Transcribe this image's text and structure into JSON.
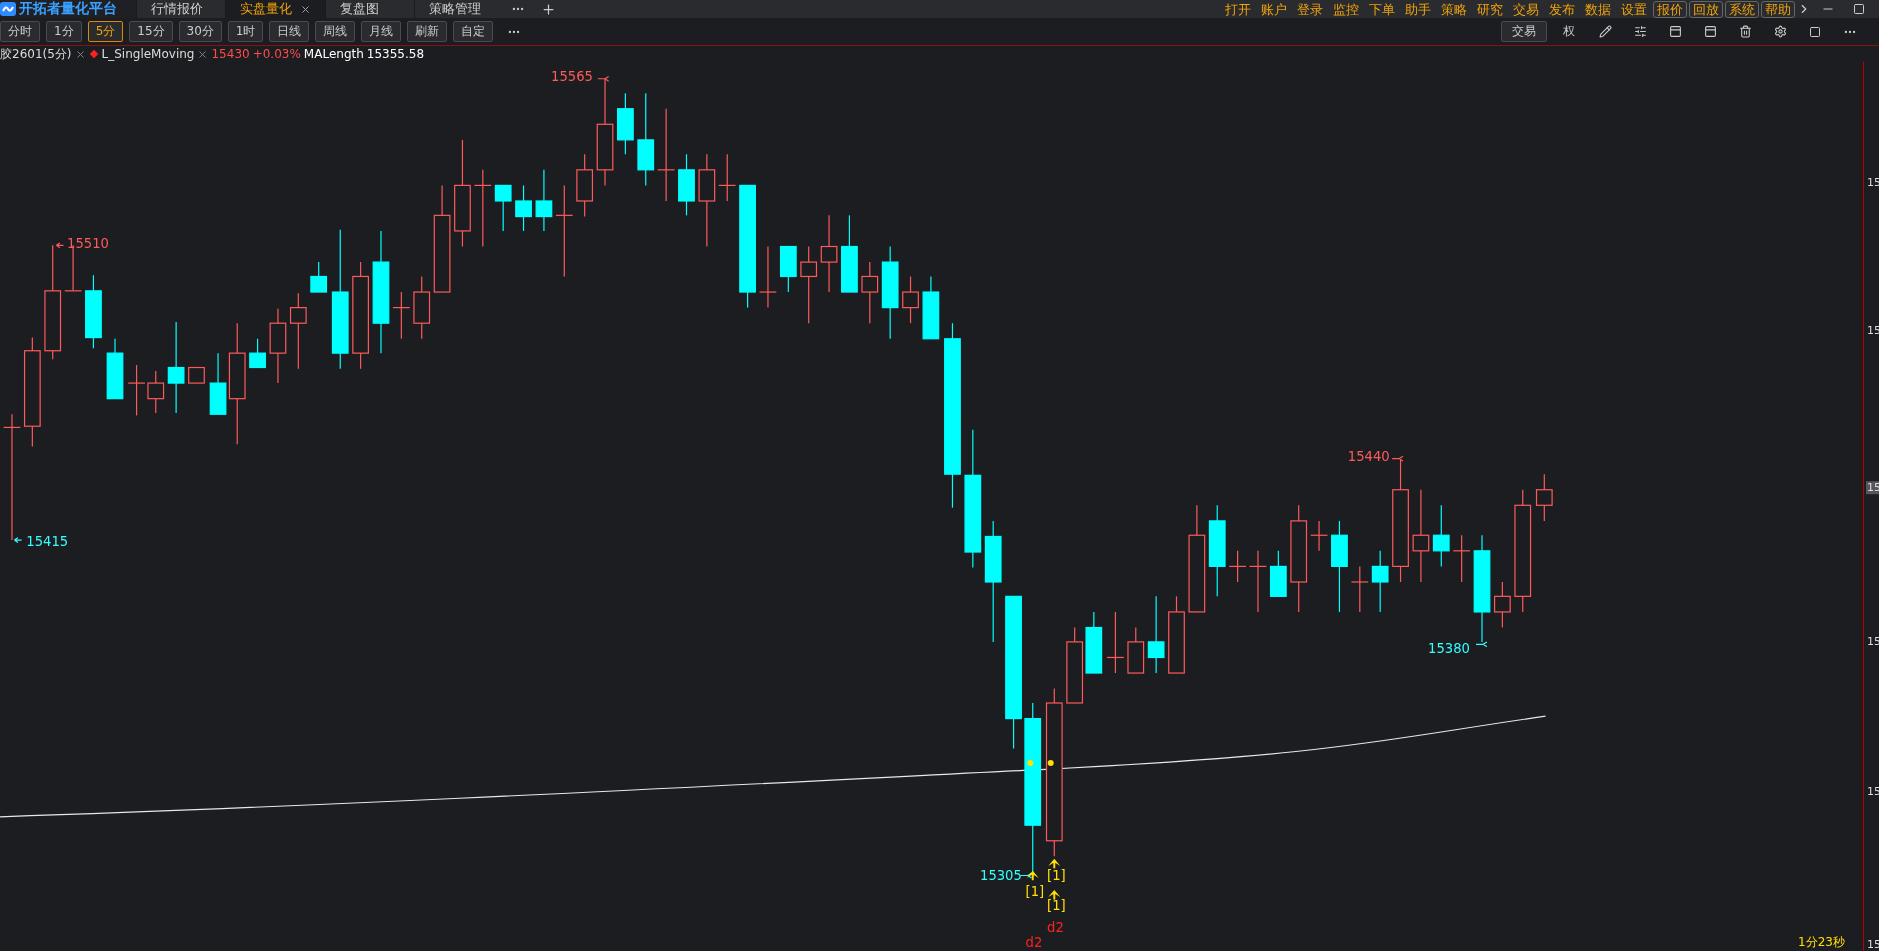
{
  "app": {
    "title": "开拓者量化平台"
  },
  "tabs": [
    {
      "label": "行情报价",
      "selected": false,
      "closable": false
    },
    {
      "label": "实盘量化",
      "selected": true,
      "closable": true
    },
    {
      "label": "复盘图",
      "selected": false,
      "closable": false
    },
    {
      "label": "策略管理",
      "selected": false,
      "closable": false
    }
  ],
  "menu": [
    {
      "label": "打开",
      "boxed": false
    },
    {
      "label": "账户",
      "boxed": false
    },
    {
      "label": "登录",
      "boxed": false
    },
    {
      "label": "监控",
      "boxed": false
    },
    {
      "label": "下单",
      "boxed": false
    },
    {
      "label": "助手",
      "boxed": false
    },
    {
      "label": "策略",
      "boxed": false
    },
    {
      "label": "研究",
      "boxed": false
    },
    {
      "label": "交易",
      "boxed": false
    },
    {
      "label": "发布",
      "boxed": false
    },
    {
      "label": "数据",
      "boxed": false
    },
    {
      "label": "设置",
      "boxed": false
    },
    {
      "label": "报价",
      "boxed": true
    },
    {
      "label": "回放",
      "boxed": true
    },
    {
      "label": "系统",
      "boxed": true
    },
    {
      "label": "帮助",
      "boxed": true
    }
  ],
  "periods": [
    {
      "label": "分时",
      "selected": false
    },
    {
      "label": "1分",
      "selected": false
    },
    {
      "label": "5分",
      "selected": true
    },
    {
      "label": "15分",
      "selected": false
    },
    {
      "label": "30分",
      "selected": false
    },
    {
      "label": "1时",
      "selected": false
    },
    {
      "label": "日线",
      "selected": false
    },
    {
      "label": "周线",
      "selected": false
    },
    {
      "label": "月线",
      "selected": false
    },
    {
      "label": "刷新",
      "selected": false
    },
    {
      "label": "自定",
      "selected": false
    }
  ],
  "toolbar": {
    "trade_button": "交易",
    "rights_button": "权"
  },
  "legend": {
    "symbol": "胶2601(5分)",
    "strategy": "L_SingleMoving",
    "price": "15430",
    "change": "+0.03%",
    "ma_label": "MALength",
    "ma_value": "15355.58"
  },
  "chart": {
    "price_labels": [
      {
        "text": "15565",
        "kind": "high"
      },
      {
        "text": "15510",
        "kind": "high"
      },
      {
        "text": "15415",
        "kind": "low"
      },
      {
        "text": "15440",
        "kind": "high"
      },
      {
        "text": "15380",
        "kind": "low"
      },
      {
        "text": "15305",
        "kind": "low"
      }
    ],
    "signals": [
      {
        "text": "[1]",
        "kind": "tag"
      },
      {
        "text": "[1]",
        "kind": "tag"
      },
      {
        "text": "[1]",
        "kind": "tag"
      },
      {
        "text": "d2",
        "kind": "exit"
      },
      {
        "text": "d2",
        "kind": "exit"
      }
    ],
    "axis_ticks": [
      {
        "label": "15",
        "selected": false
      },
      {
        "label": "15",
        "selected": false
      },
      {
        "label": "15",
        "selected": true
      },
      {
        "label": "15",
        "selected": false
      },
      {
        "label": "15",
        "selected": false
      },
      {
        "label": "15",
        "selected": false
      }
    ],
    "countdown": "1分23秒"
  }
}
